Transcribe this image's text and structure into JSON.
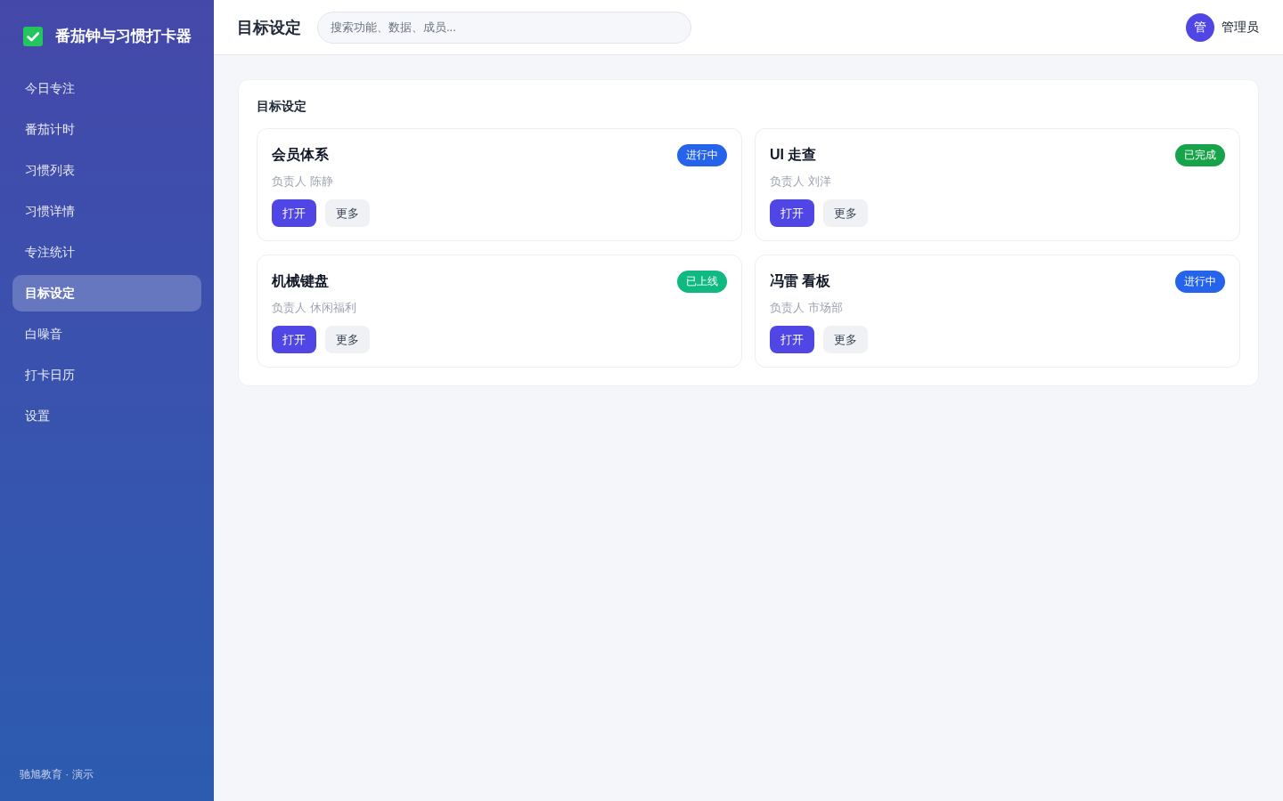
{
  "sidebar": {
    "logo": {
      "title": "番茄钟与习惯打卡器"
    },
    "nav": [
      {
        "label": "今日专注",
        "selected": false
      },
      {
        "label": "番茄计时",
        "selected": false
      },
      {
        "label": "习惯列表",
        "selected": false
      },
      {
        "label": "习惯详情",
        "selected": false
      },
      {
        "label": "专注统计",
        "selected": false
      },
      {
        "label": "目标设定",
        "selected": true
      },
      {
        "label": "白噪音",
        "selected": false
      },
      {
        "label": "打卡日历",
        "selected": false
      },
      {
        "label": "设置",
        "selected": false
      }
    ],
    "footer": "驰旭教育 · 演示"
  },
  "header": {
    "title": "目标设定",
    "search": {
      "placeholder": "搜索功能、数据、成员..."
    },
    "user": {
      "avatar": "管",
      "name": "管理员"
    }
  },
  "panel": {
    "title": "目标设定",
    "projects": [
      {
        "title": "会员体系",
        "status": {
          "label": "进行中",
          "color": "#2563eb"
        },
        "owner": "负责人 陈静",
        "actions": [
          {
            "label": "打开",
            "kind": "primary"
          },
          {
            "label": "更多",
            "kind": "secondary"
          }
        ]
      },
      {
        "title": "UI 走查",
        "status": {
          "label": "已完成",
          "color": "#16a34a"
        },
        "owner": "负责人 刘洋",
        "actions": [
          {
            "label": "打开",
            "kind": "primary"
          },
          {
            "label": "更多",
            "kind": "secondary"
          }
        ]
      },
      {
        "title": "机械键盘",
        "status": {
          "label": "已上线",
          "color": "#10b981"
        },
        "owner": "负责人 休闲福利",
        "actions": [
          {
            "label": "打开",
            "kind": "primary"
          },
          {
            "label": "更多",
            "kind": "secondary"
          }
        ]
      },
      {
        "title": "冯雷 看板",
        "status": {
          "label": "进行中",
          "color": "#2563eb"
        },
        "owner": "负责人 市场部",
        "actions": [
          {
            "label": "打开",
            "kind": "primary"
          },
          {
            "label": "更多",
            "kind": "secondary"
          }
        ]
      }
    ]
  }
}
